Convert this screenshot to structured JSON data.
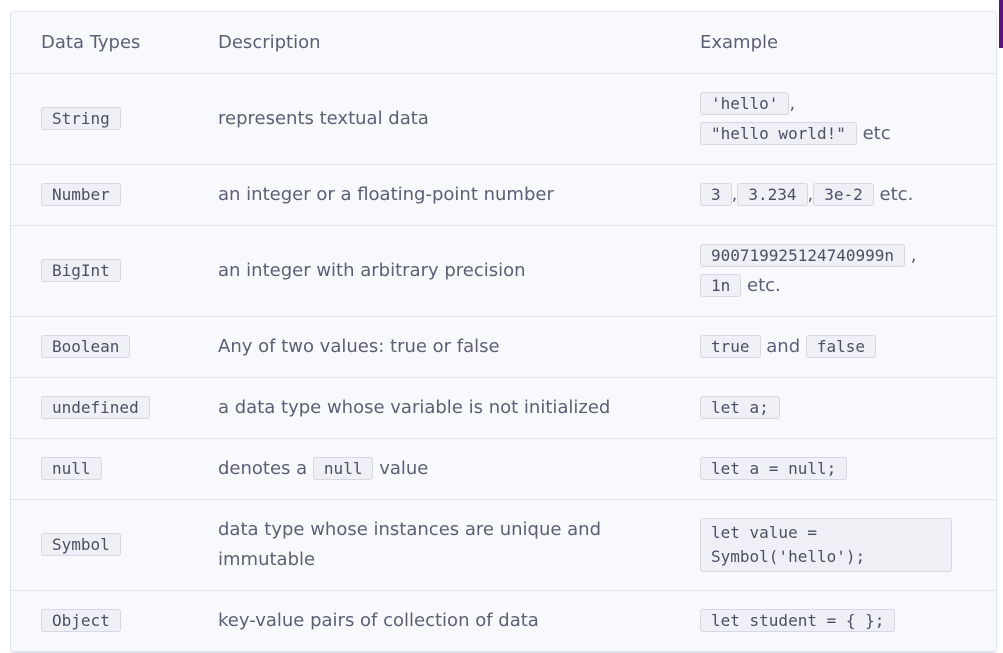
{
  "headers": [
    "Data Types",
    "Description",
    "Example"
  ],
  "rows": [
    {
      "type": "String",
      "desc": "represents textual data",
      "ex": {
        "c1": "'hello'",
        "sep1": ",",
        "c2": "\"hello world!\"",
        "tail": "etc"
      }
    },
    {
      "type": "Number",
      "desc": "an integer or a floating-point number",
      "ex": {
        "c1": "3",
        "sep1": ",",
        "c2": "3.234",
        "sep2": ",",
        "c3": "3e-2",
        "tail": "etc."
      }
    },
    {
      "type": "BigInt",
      "desc": "an integer with arbitrary precision",
      "ex": {
        "c1": "900719925124740999n",
        "sep1": ",",
        "c2": "1n",
        "tail": "etc."
      }
    },
    {
      "type": "Boolean",
      "desc": "Any of two values: true or false",
      "ex": {
        "c1": "true",
        "mid": "and",
        "c2": "false"
      }
    },
    {
      "type": "undefined",
      "desc": "a data type whose variable is not initialized",
      "ex": {
        "c1": "let a;"
      }
    },
    {
      "type": "null",
      "desc": {
        "pre": "denotes a",
        "code": "null",
        "post": "value"
      },
      "ex": {
        "c1": "let a = null;"
      }
    },
    {
      "type": "Symbol",
      "desc": {
        "line1": "data type whose instances are unique and",
        "line2": "immutable"
      },
      "ex": {
        "c1": "let value =\nSymbol('hello');"
      }
    },
    {
      "type": "Object",
      "desc": "key-value pairs of collection of data",
      "ex": {
        "c1": "let student = { };"
      }
    }
  ]
}
